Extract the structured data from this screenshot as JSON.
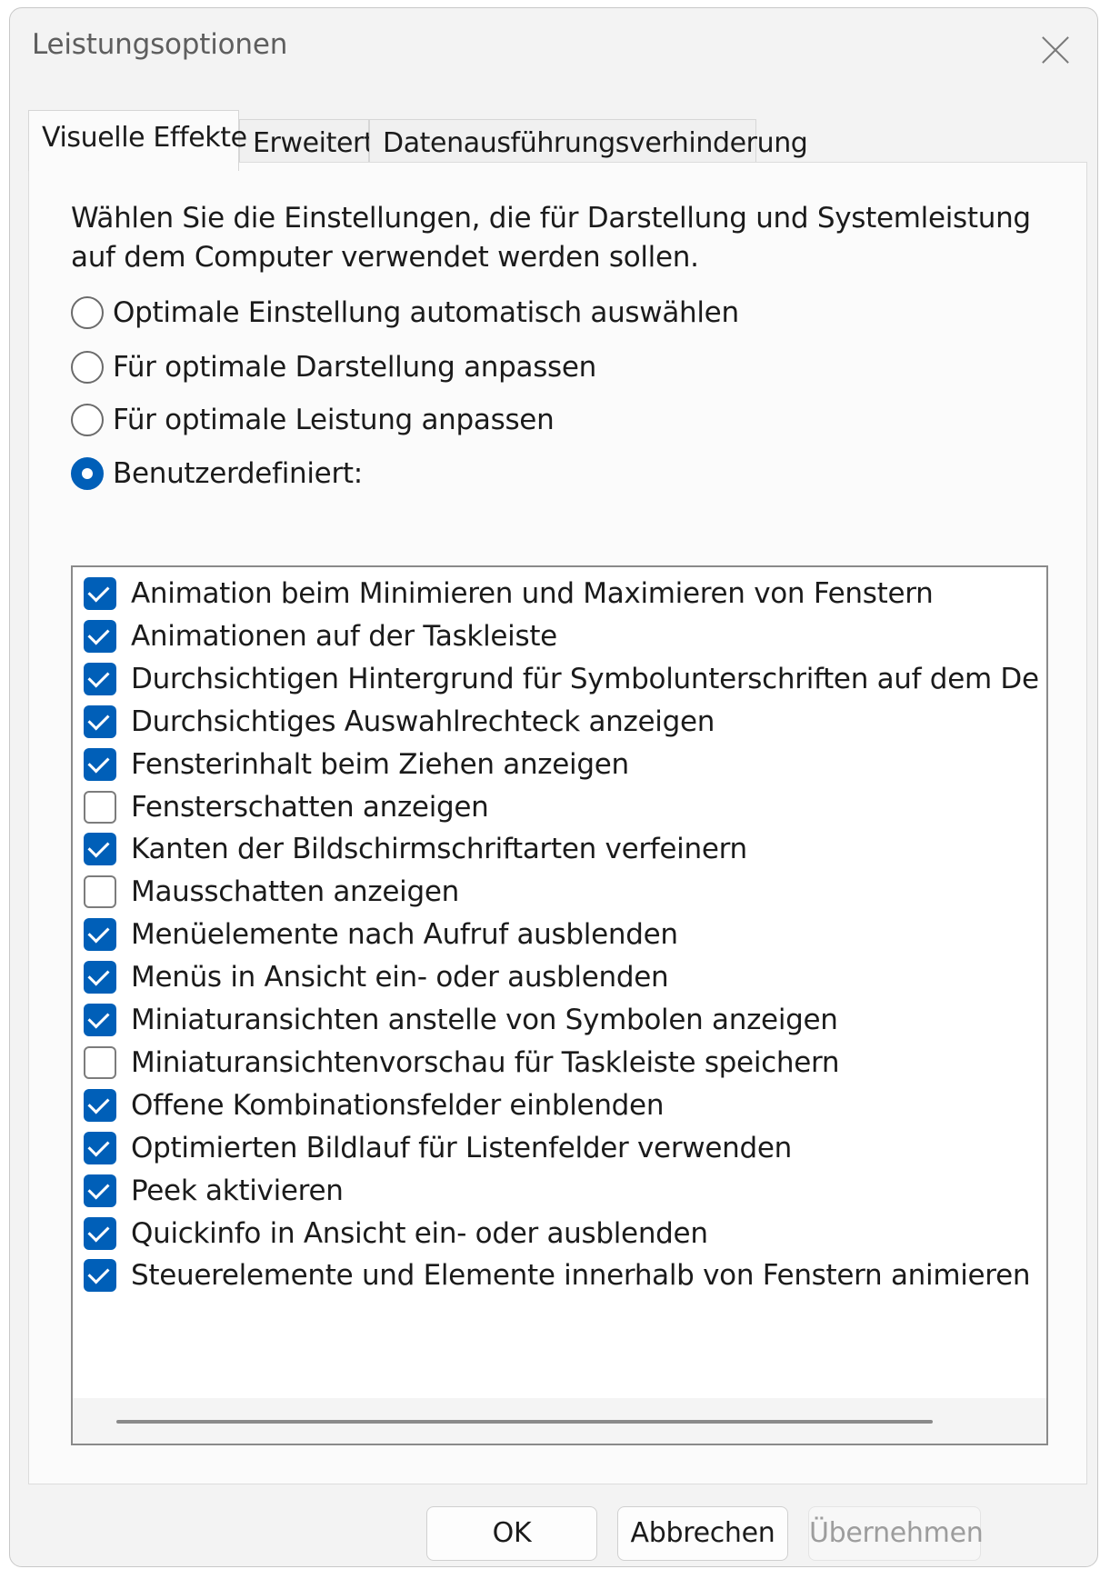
{
  "window": {
    "title": "Leistungsoptionen"
  },
  "tabs": [
    {
      "label": "Visuelle Effekte",
      "active": true
    },
    {
      "label": "Erweitert",
      "active": false
    },
    {
      "label": "Datenausführungsverhinderung",
      "active": false
    }
  ],
  "description": "Wählen Sie die Einstellungen, die für Darstellung und Systemleistung auf dem Computer verwendet werden sollen.",
  "radios": [
    {
      "label": "Optimale Einstellung automatisch auswählen",
      "checked": false
    },
    {
      "label": "Für optimale Darstellung anpassen",
      "checked": false
    },
    {
      "label": "Für optimale Leistung anpassen",
      "checked": false
    },
    {
      "label": "Benutzerdefiniert:",
      "checked": true
    }
  ],
  "effects": [
    {
      "label": "Animation beim Minimieren und Maximieren von Fenstern",
      "checked": true
    },
    {
      "label": "Animationen auf der Taskleiste",
      "checked": true
    },
    {
      "label": "Durchsichtigen Hintergrund für Symbolunterschriften auf dem De",
      "checked": true
    },
    {
      "label": "Durchsichtiges Auswahlrechteck anzeigen",
      "checked": true
    },
    {
      "label": "Fensterinhalt beim Ziehen anzeigen",
      "checked": true
    },
    {
      "label": "Fensterschatten anzeigen",
      "checked": false
    },
    {
      "label": "Kanten der Bildschirmschriftarten verfeinern",
      "checked": true
    },
    {
      "label": "Mausschatten anzeigen",
      "checked": false
    },
    {
      "label": "Menüelemente nach Aufruf ausblenden",
      "checked": true
    },
    {
      "label": "Menüs in Ansicht ein- oder ausblenden",
      "checked": true
    },
    {
      "label": "Miniaturansichten anstelle von Symbolen anzeigen",
      "checked": true
    },
    {
      "label": "Miniaturansichtenvorschau für Taskleiste speichern",
      "checked": false
    },
    {
      "label": "Offene Kombinationsfelder einblenden",
      "checked": true
    },
    {
      "label": "Optimierten Bildlauf für Listenfelder verwenden",
      "checked": true
    },
    {
      "label": "Peek aktivieren",
      "checked": true
    },
    {
      "label": "Quickinfo in Ansicht ein- oder ausblenden",
      "checked": true
    },
    {
      "label": "Steuerelemente und Elemente innerhalb von Fenstern animieren",
      "checked": true
    }
  ],
  "buttons": {
    "ok": "OK",
    "cancel": "Abbrechen",
    "apply": "Übernehmen",
    "apply_enabled": false
  },
  "colors": {
    "accent": "#005fb8",
    "disabled_text": "#9d9d9d"
  },
  "icons": {
    "close": "close-icon"
  }
}
